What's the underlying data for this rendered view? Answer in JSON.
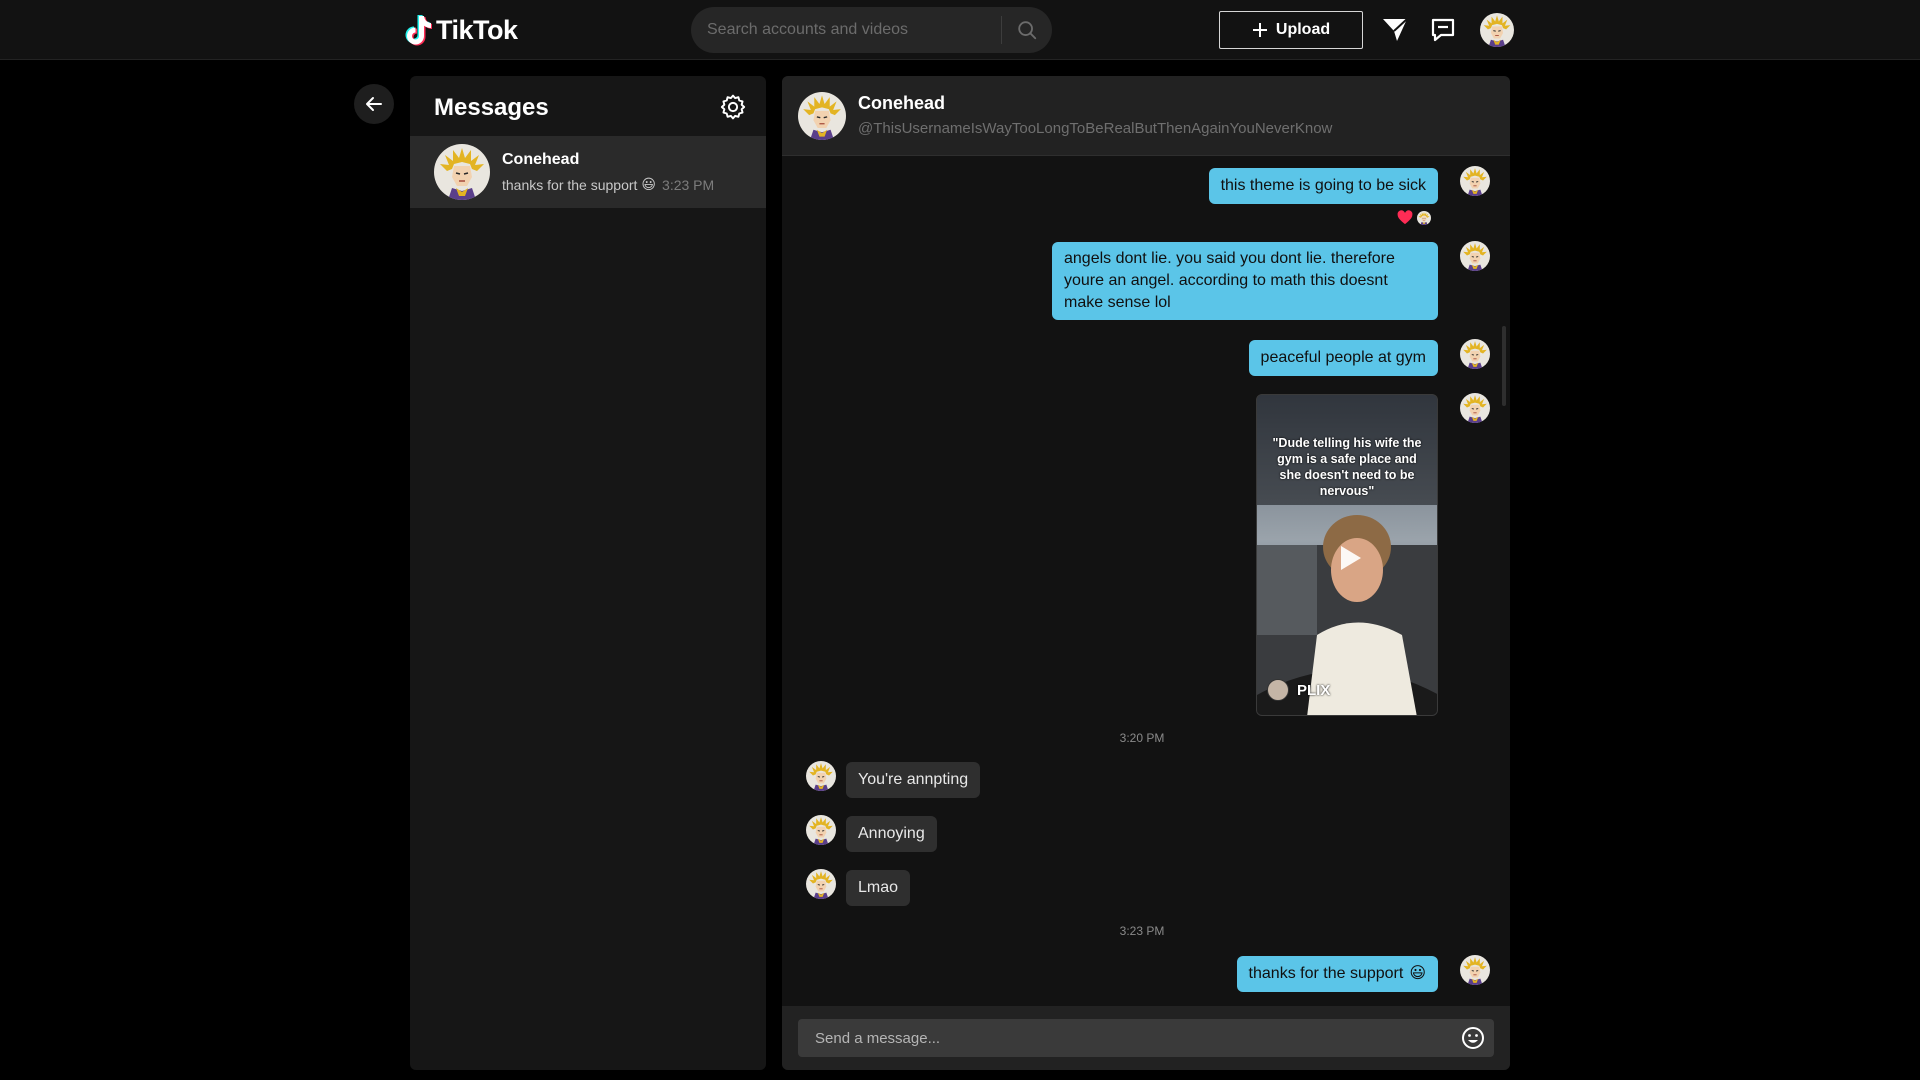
{
  "app": {
    "name": "TikTok",
    "icons": [
      "tiktok-logo-icon",
      "search-icon",
      "plus-icon",
      "send-icon",
      "message-icon",
      "back-arrow-icon",
      "gear-icon",
      "heart-icon",
      "play-icon",
      "emoji-icon"
    ]
  },
  "header": {
    "search_placeholder": "Search accounts and videos",
    "upload_label": "Upload"
  },
  "sidebar": {
    "title": "Messages",
    "conversations": [
      {
        "name": "Conehead",
        "preview": "thanks for the support",
        "preview_emoji": "😃",
        "time": "3:23 PM",
        "selected": true
      }
    ]
  },
  "chat": {
    "contact_name": "Conehead",
    "contact_handle": "@ThisUsernameIsWayTooLongToBeRealButThenAgainYouNeverKnow",
    "messages": [
      {
        "from": "me",
        "text": "this theme is going to be sick",
        "reaction": "heart"
      },
      {
        "from": "me",
        "text": "angels dont lie. you said you dont lie. therefore youre an angel. according to math this doesnt make sense lol"
      },
      {
        "from": "me",
        "text": "peaceful people at gym"
      },
      {
        "from": "me",
        "type": "video",
        "caption": "\"Dude telling his wife the gym is a safe place and she doesn't need to be nervous\"",
        "brand": "PLIX"
      },
      {
        "from": "them",
        "text": "You're annpting"
      },
      {
        "from": "them",
        "text": "Annoying"
      },
      {
        "from": "them",
        "text": "Lmao"
      },
      {
        "from": "me",
        "text": "thanks for the support",
        "emoji": "😃"
      }
    ],
    "timestamps": [
      "3:20 PM",
      "3:23 PM"
    ],
    "composer_placeholder": "Send a message..."
  },
  "colors": {
    "bubble_out": "#5bc5e8",
    "bubble_in": "#2f2f2f",
    "panel_bg": "#161616",
    "reaction_heart": "#fe2c55"
  }
}
